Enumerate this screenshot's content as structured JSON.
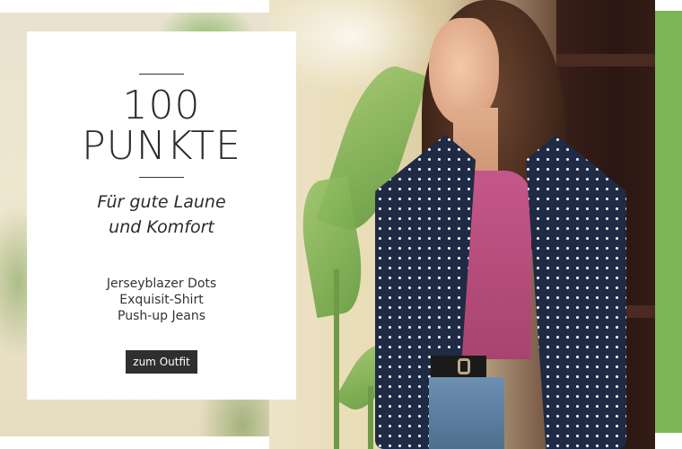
{
  "banner": {
    "headline": {
      "line1": "100",
      "line2": "PUNKTE"
    },
    "tagline": {
      "line1": "Für gute Laune",
      "line2": "und Komfort"
    },
    "products": [
      "Jerseyblazer Dots",
      "Exquisit-Shirt",
      "Push-up Jeans"
    ],
    "cta_label": "zum Outfit"
  },
  "colors": {
    "accent_green": "#7cb655",
    "button_bg": "#2f2f2f",
    "text": "#2b2b2b",
    "card_bg": "#ffffff"
  }
}
